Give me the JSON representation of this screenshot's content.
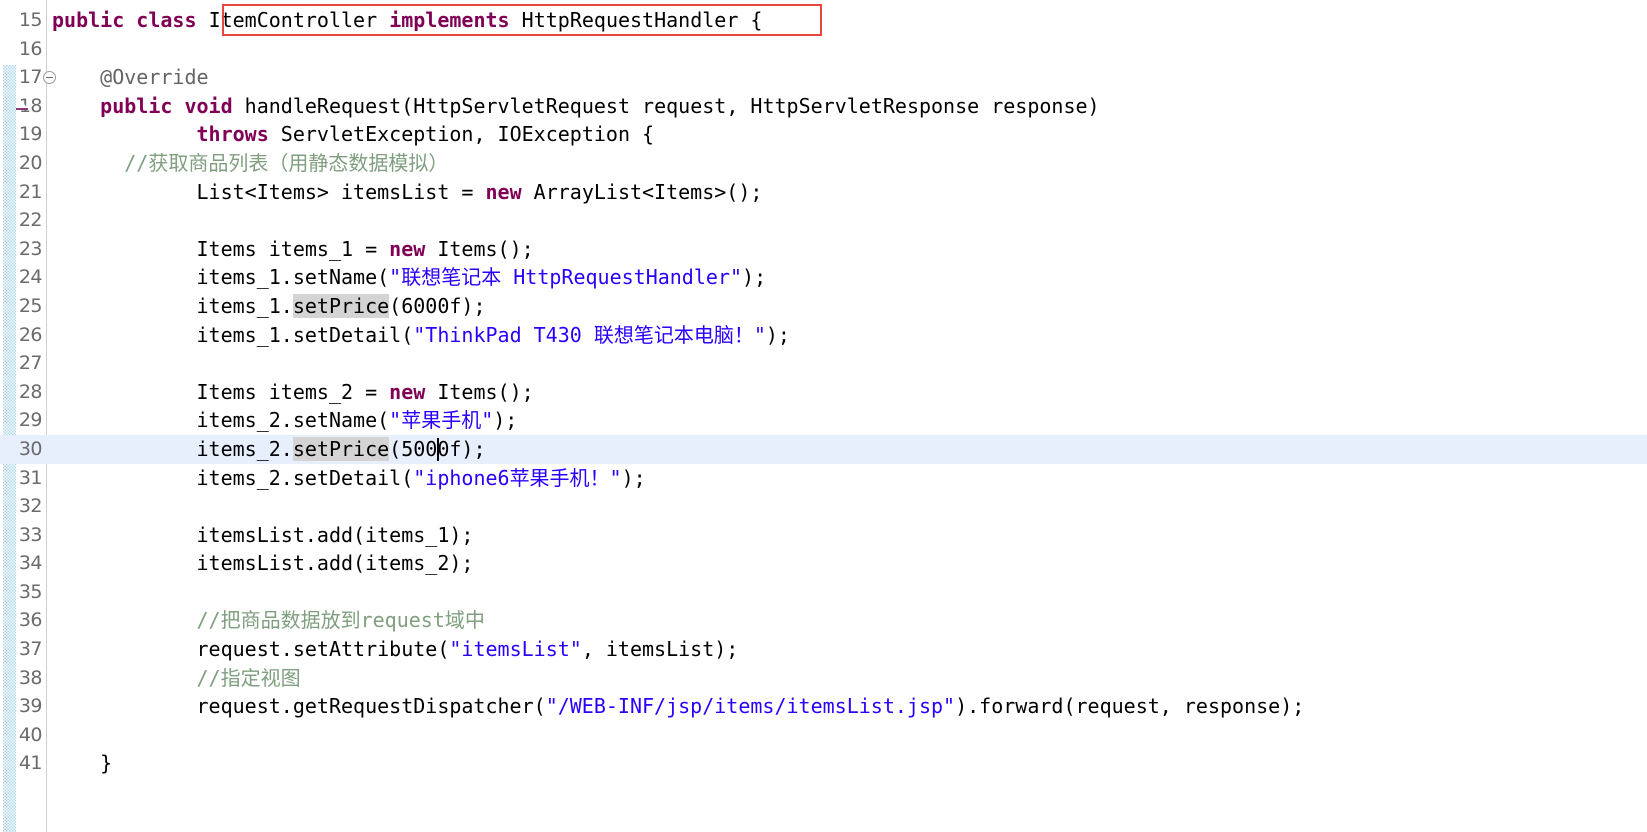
{
  "editor": {
    "app": "java-source-editor",
    "language": "Java",
    "first_line_number": 15,
    "current_line_number": 30,
    "colors": {
      "background": "#ffffff",
      "keyword": "#7f0055",
      "string": "#2a00ff",
      "comment": "#7f9f7f",
      "annotation": "#646464",
      "line_number": "#6b6b6b",
      "current_line_highlight": "#e7eefc",
      "occurrence_highlight": "#d4d4d4",
      "change_bar": "#a8d4ec",
      "annotation_box": "#e8453c"
    }
  },
  "gutter": {
    "change_bar_label": "changed-lines-indicator",
    "fold_marker_line": 17,
    "fold_marker_glyph": "⊖",
    "override_marker_line": 18,
    "override_marker_label": "implements-method-marker"
  },
  "annotation_box": {
    "label": "ItemController implements HttpRequestHandler",
    "line": 15
  },
  "lines": [
    {
      "n": 15,
      "tokens": [
        {
          "t": "public",
          "c": "kw"
        },
        {
          "t": " ",
          "c": "plain"
        },
        {
          "t": "class",
          "c": "kw"
        },
        {
          "t": " ",
          "c": "plain"
        },
        {
          "t": "ItemController ",
          "c": "plain"
        },
        {
          "t": "implements",
          "c": "kw"
        },
        {
          "t": " HttpRequestHandler {",
          "c": "plain"
        }
      ]
    },
    {
      "n": 16,
      "tokens": []
    },
    {
      "n": 17,
      "tokens": [
        {
          "t": "    @Override",
          "c": "ann"
        }
      ]
    },
    {
      "n": 18,
      "tokens": [
        {
          "t": "    ",
          "c": "plain"
        },
        {
          "t": "public",
          "c": "kw"
        },
        {
          "t": " ",
          "c": "plain"
        },
        {
          "t": "void",
          "c": "kw"
        },
        {
          "t": " handleRequest(HttpServletRequest request, HttpServletResponse response)",
          "c": "plain"
        }
      ]
    },
    {
      "n": 19,
      "tokens": [
        {
          "t": "            ",
          "c": "plain"
        },
        {
          "t": "throws",
          "c": "kw"
        },
        {
          "t": " ServletException, IOException {",
          "c": "plain"
        }
      ]
    },
    {
      "n": 20,
      "tokens": [
        {
          "t": "      //获取商品列表（用静态数据模拟）",
          "c": "cmt"
        }
      ]
    },
    {
      "n": 21,
      "tokens": [
        {
          "t": "            List<Items> itemsList = ",
          "c": "plain"
        },
        {
          "t": "new",
          "c": "kw"
        },
        {
          "t": " ArrayList<Items>();",
          "c": "plain"
        }
      ]
    },
    {
      "n": 22,
      "tokens": []
    },
    {
      "n": 23,
      "tokens": [
        {
          "t": "            Items items_1 = ",
          "c": "plain"
        },
        {
          "t": "new",
          "c": "kw"
        },
        {
          "t": " Items();",
          "c": "plain"
        }
      ]
    },
    {
      "n": 24,
      "tokens": [
        {
          "t": "            items_1.setName(",
          "c": "plain"
        },
        {
          "t": "\"联想笔记本 HttpRequestHandler\"",
          "c": "str"
        },
        {
          "t": ");",
          "c": "plain"
        }
      ]
    },
    {
      "n": 25,
      "tokens": [
        {
          "t": "            items_1.",
          "c": "plain"
        },
        {
          "t": "setPrice",
          "c": "occ"
        },
        {
          "t": "(6000f);",
          "c": "plain"
        }
      ]
    },
    {
      "n": 26,
      "tokens": [
        {
          "t": "            items_1.setDetail(",
          "c": "plain"
        },
        {
          "t": "\"ThinkPad T430 联想笔记本电脑！\"",
          "c": "str"
        },
        {
          "t": ");",
          "c": "plain"
        }
      ]
    },
    {
      "n": 27,
      "tokens": []
    },
    {
      "n": 28,
      "tokens": [
        {
          "t": "            Items items_2 = ",
          "c": "plain"
        },
        {
          "t": "new",
          "c": "kw"
        },
        {
          "t": " Items();",
          "c": "plain"
        }
      ]
    },
    {
      "n": 29,
      "tokens": [
        {
          "t": "            items_2.setName(",
          "c": "plain"
        },
        {
          "t": "\"苹果手机\"",
          "c": "str"
        },
        {
          "t": ");",
          "c": "plain"
        }
      ]
    },
    {
      "n": 30,
      "current": true,
      "tokens": [
        {
          "t": "            items_2.",
          "c": "plain"
        },
        {
          "t": "setPrice",
          "c": "occ"
        },
        {
          "t": "(5000f);",
          "c": "plain"
        }
      ]
    },
    {
      "n": 31,
      "tokens": [
        {
          "t": "            items_2.setDetail(",
          "c": "plain"
        },
        {
          "t": "\"iphone6苹果手机！\"",
          "c": "str"
        },
        {
          "t": ");",
          "c": "plain"
        }
      ]
    },
    {
      "n": 32,
      "tokens": []
    },
    {
      "n": 33,
      "tokens": [
        {
          "t": "            itemsList.add(items_1);",
          "c": "plain"
        }
      ]
    },
    {
      "n": 34,
      "tokens": [
        {
          "t": "            itemsList.add(items_2);",
          "c": "plain"
        }
      ]
    },
    {
      "n": 35,
      "tokens": []
    },
    {
      "n": 36,
      "tokens": [
        {
          "t": "            //把商品数据放到request域中",
          "c": "cmt"
        }
      ]
    },
    {
      "n": 37,
      "tokens": [
        {
          "t": "            request.setAttribute(",
          "c": "plain"
        },
        {
          "t": "\"itemsList\"",
          "c": "str"
        },
        {
          "t": ", itemsList);",
          "c": "plain"
        }
      ]
    },
    {
      "n": 38,
      "tokens": [
        {
          "t": "            //指定视图",
          "c": "cmt"
        }
      ]
    },
    {
      "n": 39,
      "tokens": [
        {
          "t": "            request.getRequestDispatcher(",
          "c": "plain"
        },
        {
          "t": "\"/WEB-INF/jsp/items/itemsList.jsp\"",
          "c": "str"
        },
        {
          "t": ").forward(request, response);",
          "c": "plain"
        }
      ]
    },
    {
      "n": 40,
      "tokens": []
    },
    {
      "n": 41,
      "tokens": [
        {
          "t": "    }",
          "c": "plain"
        }
      ]
    }
  ]
}
